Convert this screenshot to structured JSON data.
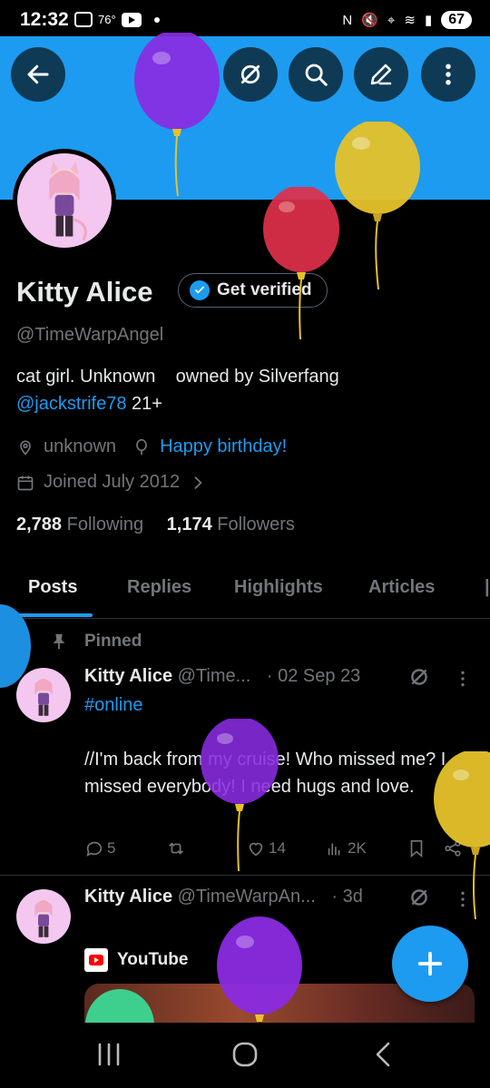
{
  "status_bar": {
    "time": "12:32",
    "temperature": "76°",
    "battery": "67"
  },
  "header": {
    "back_icon": "arrow-left-icon",
    "actions": [
      "hide-icon",
      "search-icon",
      "edit-icon",
      "more-vertical-icon"
    ]
  },
  "profile": {
    "name": "Kitty Alice",
    "verify_label": "Get verified",
    "handle": "@TimeWarpAngel",
    "bio_line1": "cat girl. Unknown    owned by Silverfang",
    "bio_mention": "@jackstrife78",
    "bio_tail": "21+",
    "location": "unknown",
    "birthday": "Happy birthday!",
    "joined": "Joined July 2012",
    "following_count": "2,788",
    "following_label": "Following",
    "followers_count": "1,174",
    "followers_label": "Followers"
  },
  "tabs": [
    "Posts",
    "Replies",
    "Highlights",
    "Articles"
  ],
  "posts": [
    {
      "pinned_label": "Pinned",
      "author": "Kitty Alice",
      "handle": "@Time...",
      "date": "· 02 Sep 23",
      "hashtag": "#online",
      "text": "//I'm back from my cruise! Who missed me? I missed everybody! I need hugs and love.",
      "replies": "5",
      "likes": "14",
      "views": "2K"
    },
    {
      "author": "Kitty Alice",
      "handle": "@TimeWarpAn...",
      "date": "· 3d",
      "link_source": "YouTube"
    }
  ],
  "colors": {
    "accent": "#1d9bf0",
    "background": "#000000",
    "text_primary": "#e7e9ea",
    "text_secondary": "#71767b",
    "balloon_purple": "#8a2be2",
    "balloon_yellow": "#e6c229",
    "balloon_red": "#e0304a"
  }
}
